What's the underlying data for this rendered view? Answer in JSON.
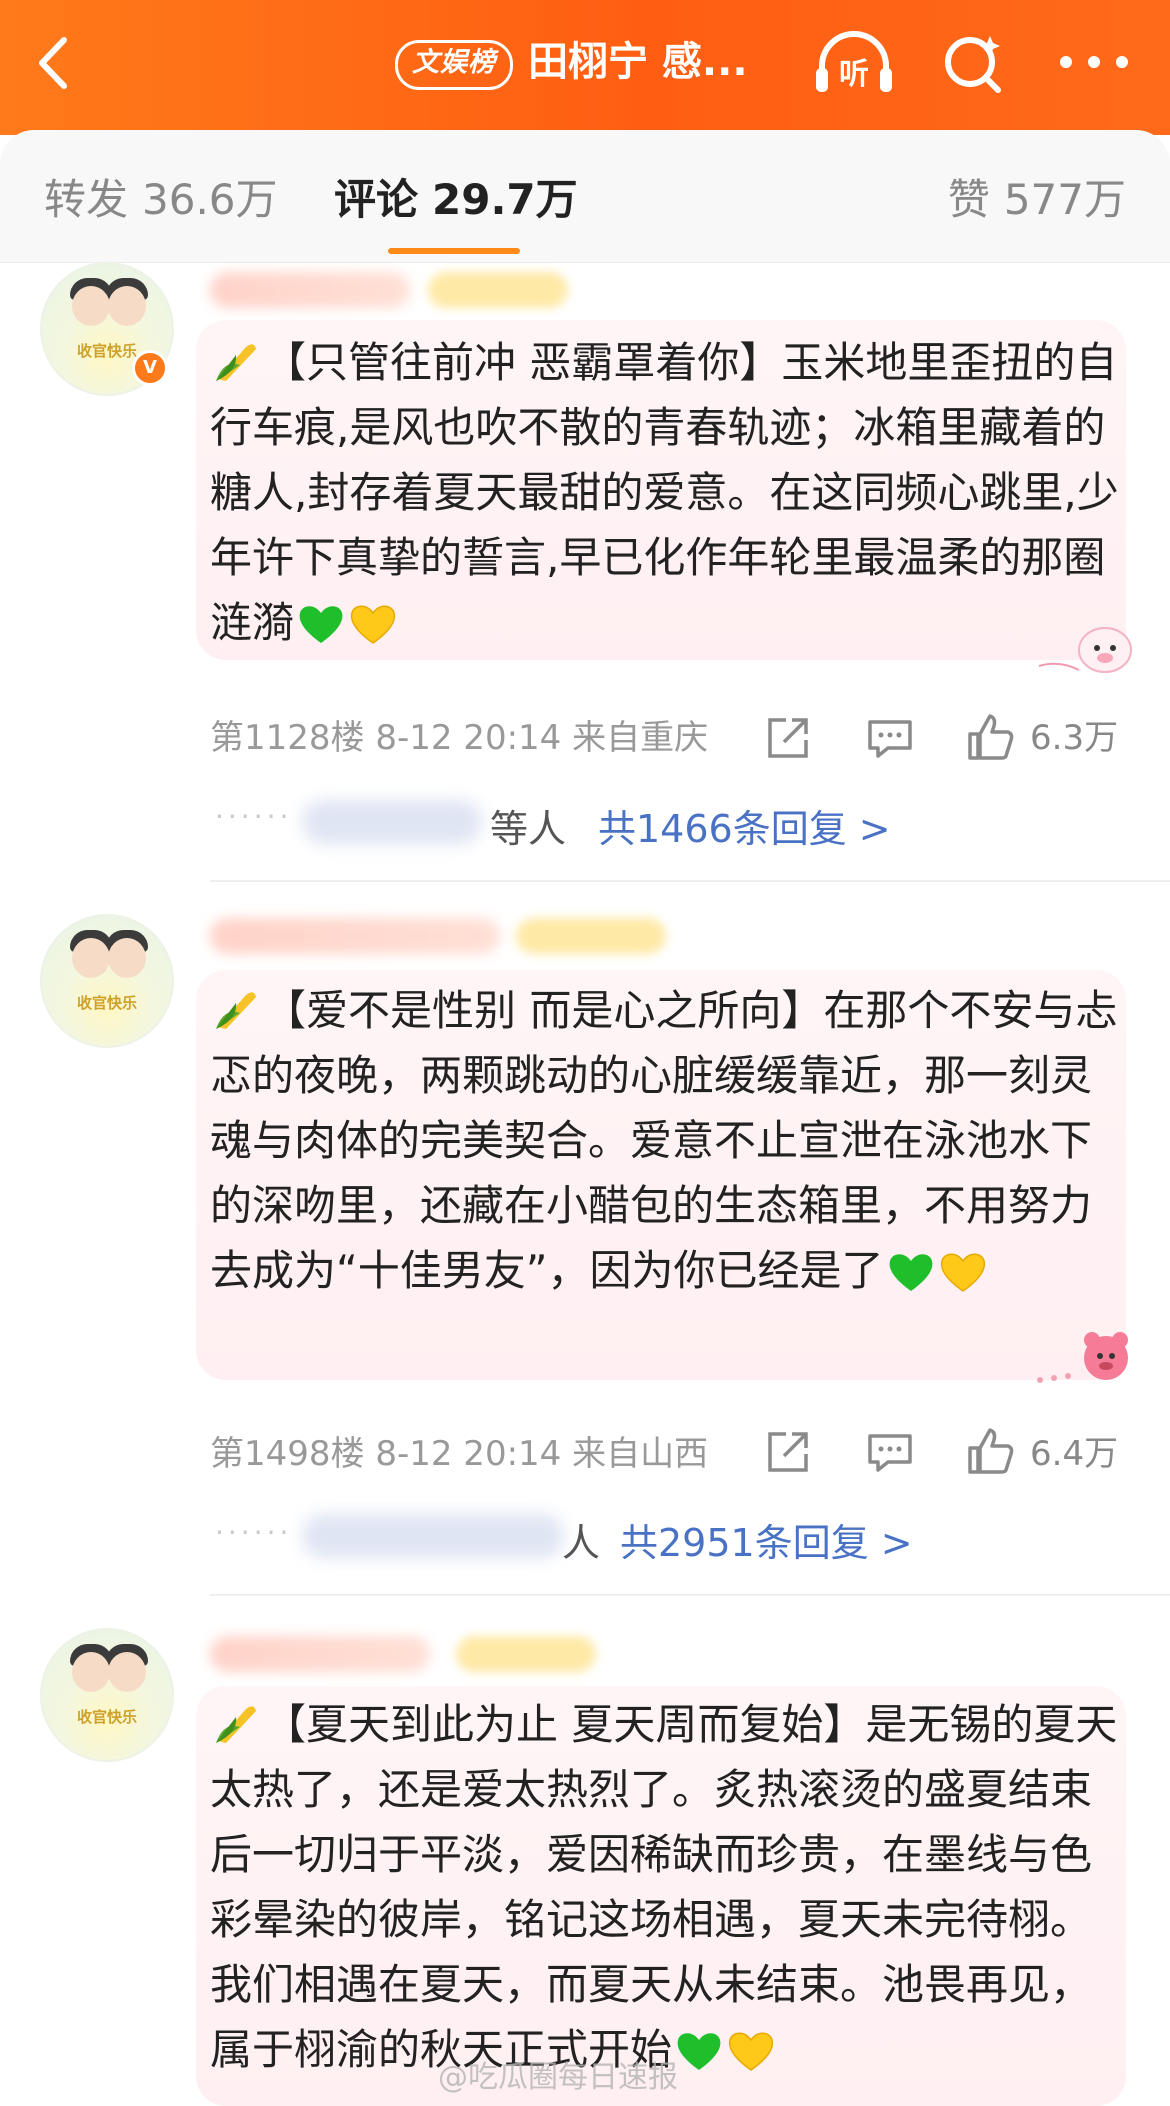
{
  "header": {
    "badge": "文娱榜",
    "title": "田栩宁 感...",
    "listen_label": "听"
  },
  "tabs": {
    "forward": {
      "label": "转发",
      "count": "36.6万"
    },
    "comments": {
      "label": "评论",
      "count": "29.7万"
    },
    "likes": {
      "label": "赞",
      "count": "577万"
    }
  },
  "comments": [
    {
      "avatar_caption": "收官快乐",
      "text": "【只管往前冲 恶霸罩着你】玉米地里歪扭的自行车痕,是风也吹不散的青春轨迹；冰箱里藏着的糖人,封存着夏天最甜的爱意。在这同频心跳里,少年许下真挚的誓言,早已化作年轮里最温柔的那圈涟漪",
      "meta": "第1128楼 8-12 20:14 来自重庆",
      "likes": "6.3万",
      "reply_suffix": "等人",
      "reply_count": "共1466条回复 >"
    },
    {
      "avatar_caption": "收官快乐",
      "text": "【爱不是性别 而是心之所向】在那个不安与忐忑的夜晚，两颗跳动的心脏缓缓靠近，那一刻灵魂与肉体的完美契合。爱意不止宣泄在泳池水下的深吻里，还藏在小醋包的生态箱里，不用努力去成为“十佳男友”，因为你已经是了",
      "meta": "第1498楼 8-12 20:14 来自山西",
      "likes": "6.4万",
      "reply_suffix": "人",
      "reply_count": "共2951条回复 >"
    },
    {
      "avatar_caption": "收官快乐",
      "text": "【夏天到此为止 夏天周而复始】是无锡的夏天太热了，还是爱太热烈了。炙热滚烫的盛夏结束后一切归于平淡，爱因稀缺而珍贵，在墨线与色彩晕染的彼岸，铭记这场相遇，夏天未完待栩。我们相遇在夏天，而夏天从未结束。池畏再见，属于栩渝的秋天正式开始"
    }
  ],
  "watermark": "@吃瓜圈每日速报",
  "colors": {
    "accent": "#ff6a13",
    "link": "#4a72c4",
    "bubble": "#ffeff2"
  }
}
